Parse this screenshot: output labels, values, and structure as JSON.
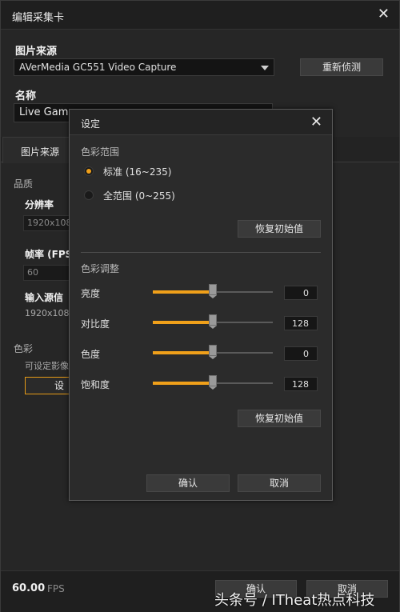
{
  "window": {
    "title": "编辑采集卡",
    "source_label": "图片来源",
    "source_value": "AVerMedia GC551 Video Capture",
    "redetect_label": "重新侦测",
    "name_label": "名称",
    "name_value": "Live Game",
    "tab_label": "图片来源",
    "quality_label": "品质",
    "resolution_label": "分辨率",
    "resolution_value": "1920x108",
    "framerate_label": "帧率 (FPS",
    "framerate_value": "60",
    "input_label": "输入源信",
    "input_value": "1920x108",
    "color_label": "色彩",
    "color_desc": "可设定影像",
    "settings_button": "设",
    "fps_value": "60.00",
    "fps_unit": "FPS",
    "ok_label": "确认",
    "cancel_label": "取消"
  },
  "dialog": {
    "title": "设定",
    "color_range_label": "色彩范围",
    "range_options": [
      {
        "label": "标准 (16~235)",
        "selected": true
      },
      {
        "label": "全范围 (0~255)",
        "selected": false
      }
    ],
    "reset_label_1": "恢复初始值",
    "color_adjust_label": "色彩调整",
    "sliders": [
      {
        "label": "亮度",
        "value": "0",
        "fraction": 0.5
      },
      {
        "label": "对比度",
        "value": "128",
        "fraction": 0.5
      },
      {
        "label": "色度",
        "value": "0",
        "fraction": 0.5
      },
      {
        "label": "饱和度",
        "value": "128",
        "fraction": 0.5
      }
    ],
    "reset_label_2": "恢复初始值",
    "ok_label": "确认",
    "cancel_label": "取消"
  },
  "watermark": "头条号 / ITheat热点科技",
  "colors": {
    "accent": "#f0a01a",
    "background": "#262626"
  }
}
